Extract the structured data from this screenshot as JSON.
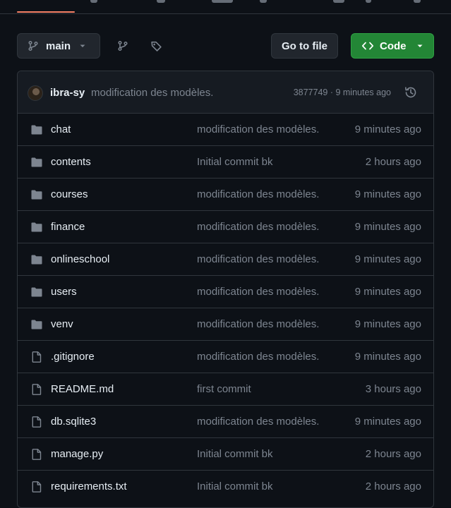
{
  "toolbar": {
    "branch_label": "main",
    "go_to_file_label": "Go to file",
    "code_label": "Code"
  },
  "commit": {
    "author": "ibra-sy",
    "message": "modification des modèles.",
    "meta": "3877749 · 9 minutes ago"
  },
  "files": [
    {
      "name": "chat",
      "type": "folder",
      "message": "modification des modèles.",
      "date": "9 minutes ago"
    },
    {
      "name": "contents",
      "type": "folder",
      "message": "Initial commit bk",
      "date": "2 hours ago"
    },
    {
      "name": "courses",
      "type": "folder",
      "message": "modification des modèles.",
      "date": "9 minutes ago"
    },
    {
      "name": "finance",
      "type": "folder",
      "message": "modification des modèles.",
      "date": "9 minutes ago"
    },
    {
      "name": "onlineschool",
      "type": "folder",
      "message": "modification des modèles.",
      "date": "9 minutes ago"
    },
    {
      "name": "users",
      "type": "folder",
      "message": "modification des modèles.",
      "date": "9 minutes ago"
    },
    {
      "name": "venv",
      "type": "folder",
      "message": "modification des modèles.",
      "date": "9 minutes ago"
    },
    {
      "name": ".gitignore",
      "type": "file",
      "message": "modification des modèles.",
      "date": "9 minutes ago"
    },
    {
      "name": "README.md",
      "type": "file",
      "message": "first commit",
      "date": "3 hours ago"
    },
    {
      "name": "db.sqlite3",
      "type": "file",
      "message": "modification des modèles.",
      "date": "9 minutes ago"
    },
    {
      "name": "manage.py",
      "type": "file",
      "message": "Initial commit bk",
      "date": "2 hours ago"
    },
    {
      "name": "requirements.txt",
      "type": "file",
      "message": "Initial commit bk",
      "date": "2 hours ago"
    }
  ],
  "colors": {
    "background": "#0d1117",
    "accent_green": "#238636",
    "tab_underline": "#f78166",
    "muted_text": "#7d8590",
    "icon_gray": "#7d8590"
  }
}
